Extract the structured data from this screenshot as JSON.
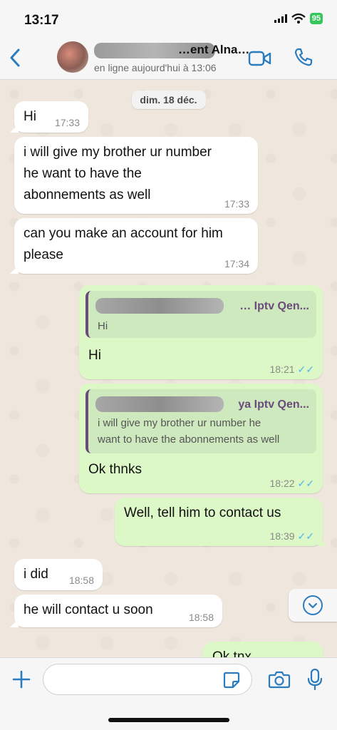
{
  "status_bar": {
    "time": "13:17",
    "battery": "95",
    "battery_color": "#34c759"
  },
  "header": {
    "contact_name": "…ent Alna…",
    "contact_status": "en ligne aujourd'hui à 13:06",
    "icons": [
      "chevron-left-icon",
      "video-camera-icon",
      "phone-icon"
    ],
    "accent_color": "#2b7bbf"
  },
  "chat": {
    "date_chip": "dim. 18 déc.",
    "messages": [
      {
        "dir": "in",
        "lines": [
          "Hi"
        ],
        "time": "17:33"
      },
      {
        "dir": "in",
        "lines": [
          "i will give my brother ur number",
          "he want to have the",
          "abonnements as well"
        ],
        "time": "17:33"
      },
      {
        "dir": "in",
        "lines": [
          "can you make an account for him",
          "please"
        ],
        "time": "17:34"
      },
      {
        "dir": "out",
        "quote_author": "… Iptv Qen...",
        "quote_lines": [
          "Hi"
        ],
        "lines": [
          "Hi"
        ],
        "time": "18:21",
        "ticks": "✓✓"
      },
      {
        "dir": "out",
        "quote_author": "ya Iptv Qen...",
        "quote_lines": [
          "i will give my brother ur number  he",
          "want to have the abonnements as well"
        ],
        "lines": [
          "Ok thnks"
        ],
        "time": "18:22",
        "ticks": "✓✓"
      },
      {
        "dir": "out",
        "lines": [
          "Well, tell him to contact us"
        ],
        "time": "18:39",
        "ticks": "✓✓"
      },
      {
        "dir": "in",
        "lines": [
          "i did"
        ],
        "time": "18:58"
      },
      {
        "dir": "in",
        "lines": [
          "he will contact u soon"
        ],
        "time": "18:58"
      },
      {
        "dir": "out",
        "lines": [
          "Ok tnx"
        ],
        "time": ""
      }
    ],
    "bubble_colors": {
      "incoming": "#ffffff",
      "outgoing": "#dcf8c6",
      "tick": "#4fb6ec"
    }
  },
  "input_bar": {
    "placeholder": "",
    "icons": [
      "plus-icon",
      "sticker-icon",
      "camera-icon",
      "microphone-icon"
    ]
  }
}
